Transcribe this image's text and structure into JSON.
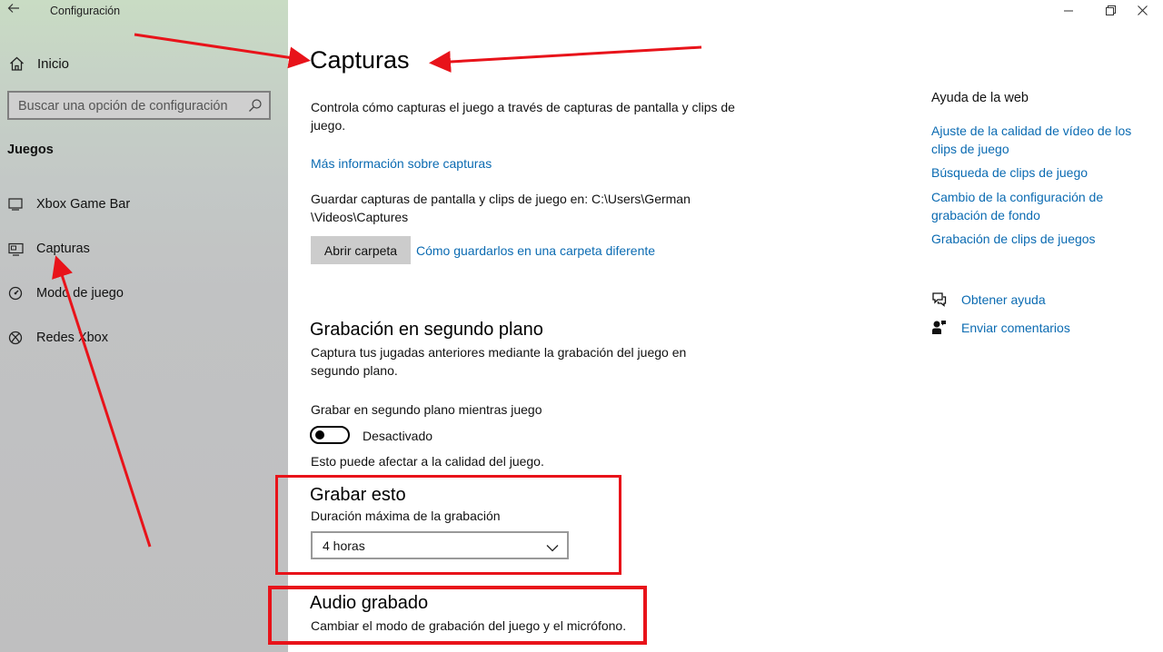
{
  "window": {
    "title": "Configuración",
    "controls": [
      "minimize-icon",
      "restore-icon",
      "close-icon"
    ]
  },
  "sidebar": {
    "home_label": "Inicio",
    "search_placeholder": "Buscar una opción de configuración",
    "section": "Juegos",
    "items": [
      {
        "label": "Xbox Game Bar",
        "icon": "xbox-game-bar-icon"
      },
      {
        "label": "Capturas",
        "icon": "captures-icon"
      },
      {
        "label": "Modo de juego",
        "icon": "game-mode-icon"
      },
      {
        "label": "Redes Xbox",
        "icon": "xbox-icon"
      }
    ]
  },
  "main": {
    "title": "Capturas",
    "description": "Controla cómo capturas el juego a través de capturas de pantalla y clips de juego.",
    "more_info_link": "Más información sobre capturas",
    "save_path_text": "Guardar capturas de pantalla y clips de juego en: C:\\Users\\German \\Videos\\Captures",
    "open_folder_button": "Abrir carpeta",
    "change_folder_link": "Cómo guardarlos en una carpeta diferente",
    "background_recording": {
      "heading": "Grabación en segundo plano",
      "description": "Captura tus jugadas anteriores mediante la grabación del juego en segundo plano.",
      "toggle_label": "Grabar en segundo plano mientras juego",
      "toggle_state": "Desactivado",
      "note": "Esto puede afectar a la calidad del juego."
    },
    "record_this": {
      "heading": "Grabar esto",
      "label": "Duración máxima de la grabación",
      "selected": "4 horas"
    },
    "recorded_audio": {
      "heading": "Audio grabado",
      "description": "Cambiar el modo de grabación del juego y el micrófono."
    }
  },
  "help": {
    "heading": "Ayuda de la web",
    "links": [
      "Ajuste de la calidad de vídeo de los clips de juego",
      "Búsqueda de clips de juego",
      "Cambio de la configuración de grabación de fondo",
      "Grabación de clips de juegos"
    ],
    "get_help": "Obtener ayuda",
    "send_feedback": "Enviar comentarios"
  },
  "colors": {
    "link": "#0b6bb2",
    "annotation_red": "#e8131a"
  }
}
